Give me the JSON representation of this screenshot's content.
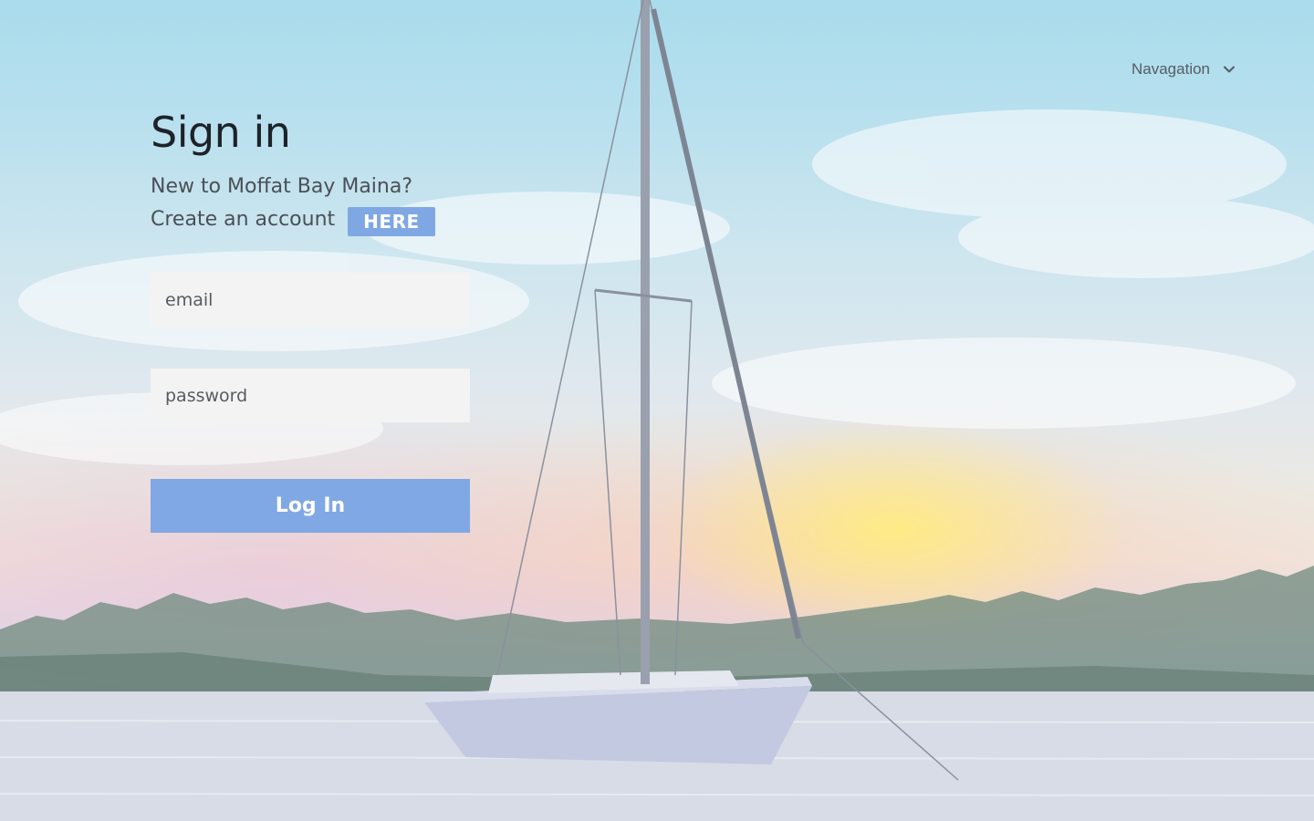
{
  "colors": {
    "accent": "#80a8e4",
    "input_bg": "#f3f3f3",
    "heading": "#1d2329",
    "subtext": "#4a5056"
  },
  "nav": {
    "label": "Navagation",
    "icon": "chevron-down-icon"
  },
  "signin": {
    "title": "Sign in",
    "prompt": "New to Moffat Bay Maina?",
    "create_text": "Create an account",
    "here_label": "HERE",
    "email_placeholder": "email",
    "password_placeholder": "password",
    "login_label": "Log In"
  }
}
